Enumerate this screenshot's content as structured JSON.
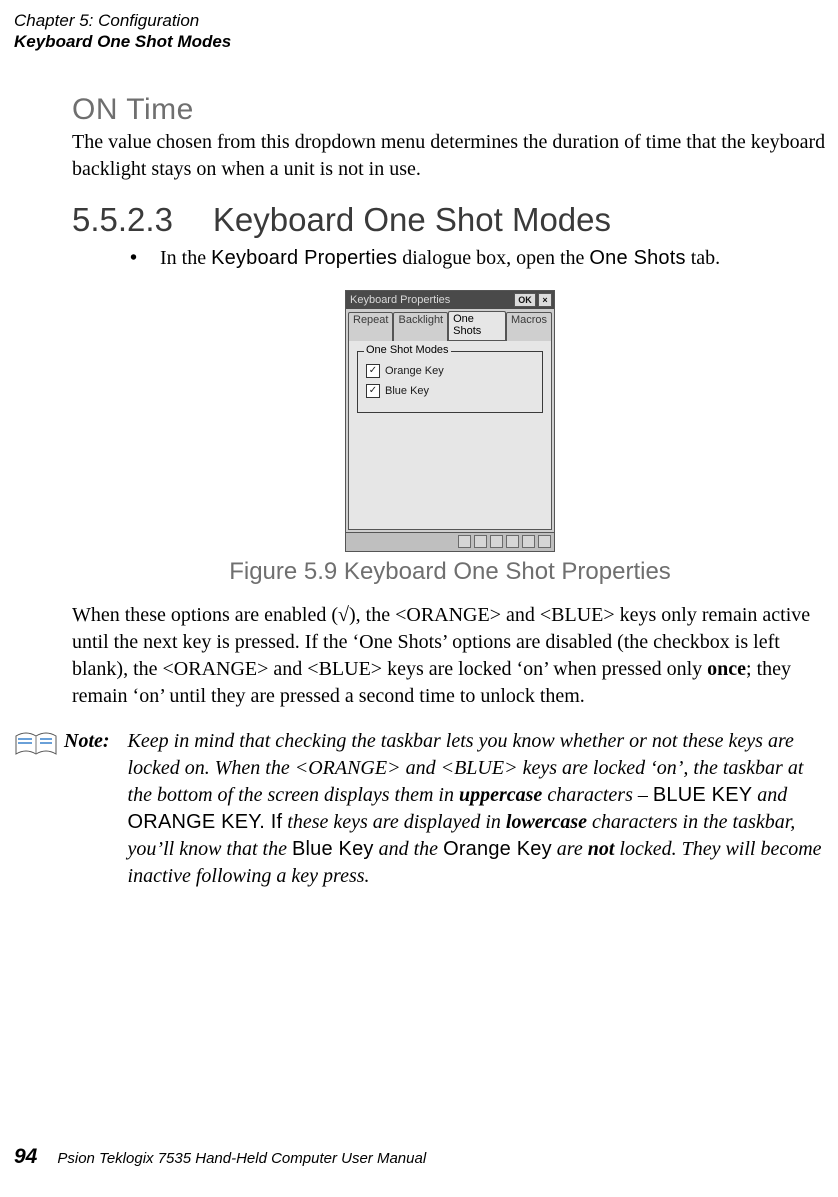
{
  "header": {
    "chapter": "Chapter 5: Configuration",
    "section": "Keyboard One Shot Modes"
  },
  "onTime": {
    "heading": "ON Time",
    "text": "The value chosen from this dropdown menu determines the duration of time that the keyboard backlight stays on when a unit is not in use."
  },
  "sec": {
    "num": "5.5.2.3",
    "title": "Keyboard One Shot Modes",
    "bullet_pre": "In the ",
    "bullet_kp": "Keyboard Properties",
    "bullet_mid": " dialogue box, open the ",
    "bullet_os": "One Shots",
    "bullet_post": " tab."
  },
  "dialog": {
    "title": "Keyboard Properties",
    "ok": "OK",
    "close": "×",
    "tabs": {
      "repeat": "Repeat",
      "backlight": "Backlight",
      "oneshots": "One Shots",
      "macros": "Macros"
    },
    "group": "One Shot Modes",
    "orange": "Orange Key",
    "blue": "Blue Key",
    "check": "✓"
  },
  "figcap": "Figure 5.9 Keyboard One Shot Properties",
  "para2_a": "When these options are enabled (",
  "para2_root": "√",
  "para2_b": "), the <ORANGE> and <BLUE> keys only remain active until the next key is pressed. If the ‘One Shots’ options are disabled (the checkbox is left blank), the <ORANGE> and <BLUE> keys are locked ‘on’ when pressed only ",
  "para2_once": "once",
  "para2_c": "; they remain ‘on’ until they are pressed a second time to unlock them.",
  "note": {
    "label": "Note:",
    "t1": "Keep in mind that checking the taskbar lets you know whether or not these keys are locked on. When the <ORANGE> and <BLUE> keys are locked ‘on’, the taskbar at the bottom of the screen displays them in ",
    "upper": "uppercase",
    "t2": " characters – ",
    "bluekey_up": "BLUE KEY",
    "and1": " and ",
    "orangekey_up": "ORANGE KEY. If",
    "t3": " these keys are displayed in ",
    "lower": "lowercase",
    "t4": " characters in the taskbar, you’ll know that the ",
    "bluekey": "Blue Key",
    "t5": " and the ",
    "orangekey": "Orange Key",
    "t6": " are ",
    "not": "not",
    "t7": " locked. They will become inactive following a key press."
  },
  "footer": {
    "page": "94",
    "manual": "Psion Teklogix 7535 Hand-Held Computer User Manual"
  }
}
